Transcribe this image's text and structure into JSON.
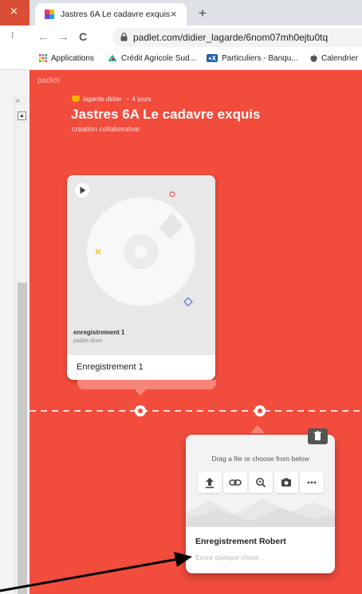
{
  "browser": {
    "left_tab_close_glyph": "×",
    "tab_title": "Jastres 6A Le cadavre exquis",
    "tab_close_glyph": "×",
    "new_tab_glyph": "+",
    "back_glyph": "←",
    "forward_glyph": "→",
    "reload_glyph": "C",
    "url": "padlet.com/didier_lagarde/6nom07mh0ejtu0tq",
    "bookmarks": [
      {
        "label": "Applications",
        "icon": "apps-grid-icon"
      },
      {
        "label": "Crédit Agricole Sud...",
        "icon": "credit-agricole-icon"
      },
      {
        "label": "Particuliers - Banqu...",
        "icon": "plus-bank-icon"
      },
      {
        "label": "Calendrier",
        "icon": "apple-icon"
      }
    ]
  },
  "padlet": {
    "logo": "padlet",
    "author": "lagarde didier",
    "separator": "•",
    "age": "4 jours",
    "title": "Jastres 6A Le cadavre exquis",
    "subtitle": "création collaborative",
    "accent_color": "#f24c3d",
    "posts": [
      {
        "attachment_name": "enregistrement 1",
        "attachment_source": "padlet drive",
        "title": "Enregistrement 1"
      },
      {
        "upload_hint": "Drag a file or choose from below",
        "tools": [
          "upload-icon",
          "link-icon",
          "search-icon",
          "camera-icon",
          "more-icon"
        ],
        "title": "Enregistrement Robert",
        "body_placeholder": "Ecrire quelque chose..."
      }
    ]
  }
}
